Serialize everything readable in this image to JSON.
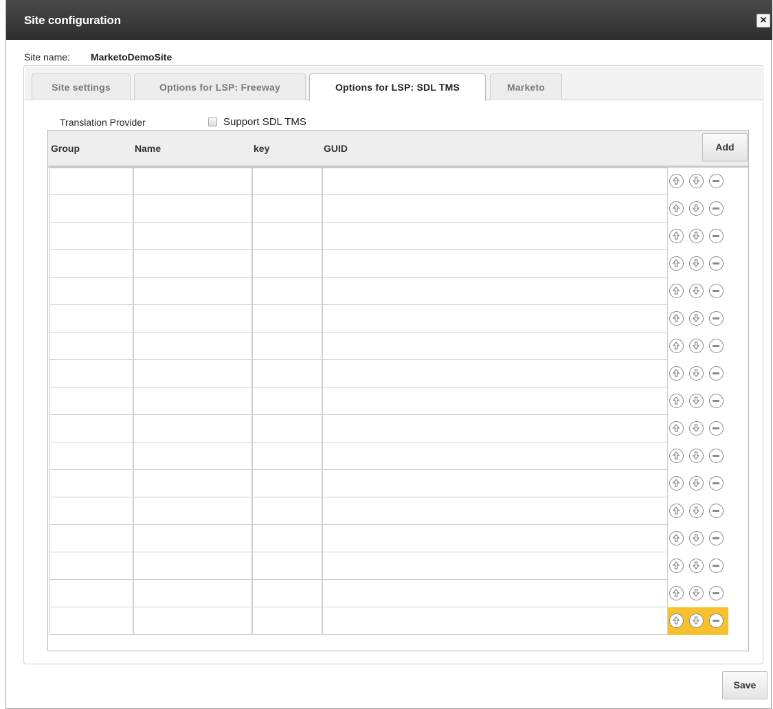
{
  "dialog": {
    "title": "Site configuration",
    "close_label": "×"
  },
  "site": {
    "label": "Site name:",
    "value": "MarketoDemoSite"
  },
  "tabs": [
    {
      "label": "Site settings",
      "active": false
    },
    {
      "label": "Options for LSP: Freeway",
      "active": false
    },
    {
      "label": "Options for LSP: SDL TMS",
      "active": true
    },
    {
      "label": "Marketo",
      "active": false
    }
  ],
  "provider": {
    "label": "Translation Provider",
    "support_label": "Support SDL TMS",
    "support_checked": false
  },
  "grid": {
    "columns": [
      "Group",
      "Name",
      "key",
      "GUID"
    ],
    "add_label": "Add",
    "row_count": 17,
    "highlighted_row": 17
  },
  "footer": {
    "save_label": "Save"
  },
  "colors": {
    "titlebar": "#3a3a3a",
    "highlight": "#f7c12d"
  }
}
